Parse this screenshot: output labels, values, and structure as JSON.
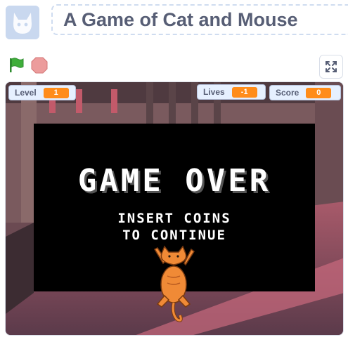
{
  "header": {
    "project_title": "A Game of Cat and Mouse",
    "thumbnail_icon": "scratch-cat-icon"
  },
  "controls": {
    "green_flag_icon": "green-flag-icon",
    "stop_icon": "stop-sign-icon",
    "fullscreen_icon": "fullscreen-icon"
  },
  "stage": {
    "monitors": [
      {
        "label": "Level",
        "value": "1"
      },
      {
        "label": "Lives",
        "value": "-1"
      },
      {
        "label": "Score",
        "value": "0"
      }
    ],
    "game_over": {
      "title": "GAME OVER",
      "line1": "INSERT COINS",
      "line2": "TO CONTINUE"
    },
    "sprite": "cat-sprite"
  },
  "colors": {
    "monitor_value": "#ff8c1a",
    "flag": "#3fae3a",
    "stop": "#ec9c9c",
    "title_text": "#575e75"
  }
}
